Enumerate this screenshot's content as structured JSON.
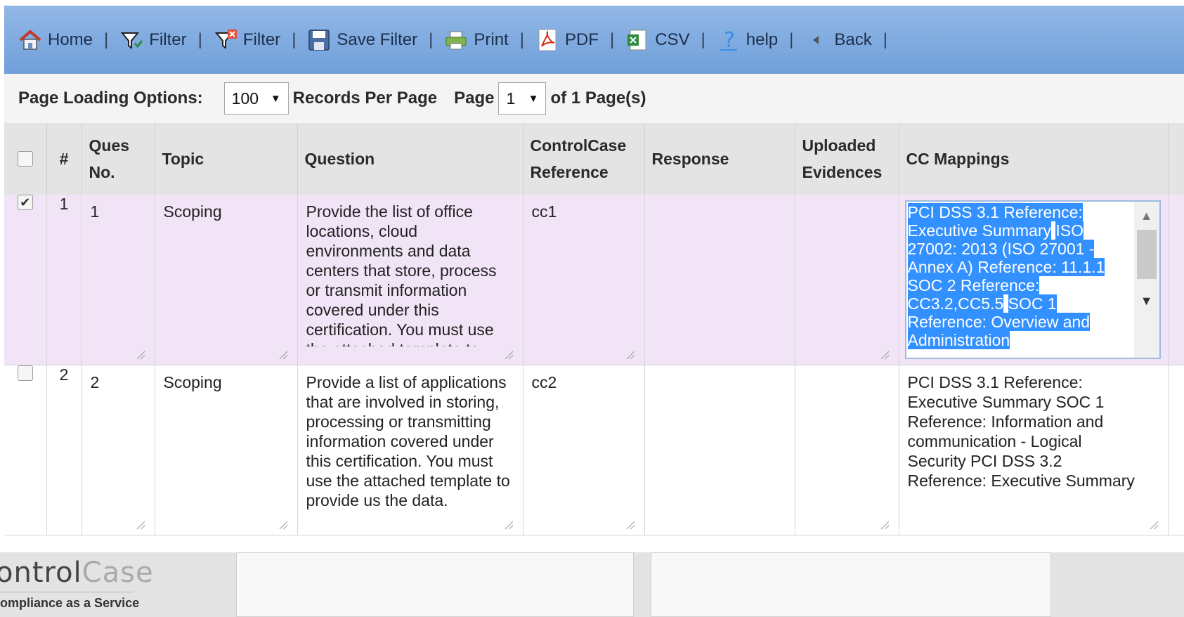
{
  "toolbar": {
    "items": [
      {
        "label": "Home",
        "icon": "home-icon"
      },
      {
        "label": "Filter",
        "icon": "filter-icon"
      },
      {
        "label": "Filter",
        "icon": "clear-filter-icon"
      },
      {
        "label": "Save Filter",
        "icon": "save-icon"
      },
      {
        "label": "Print",
        "icon": "printer-icon"
      },
      {
        "label": "PDF",
        "icon": "pdf-icon"
      },
      {
        "label": "CSV",
        "icon": "csv-icon"
      },
      {
        "label": "help",
        "icon": "help-icon"
      },
      {
        "label": "Back",
        "icon": "back-arrow-icon"
      }
    ],
    "separator": "|"
  },
  "options": {
    "label": "Page Loading Options:",
    "records_per_page": "100",
    "records_label": "Records Per Page",
    "page_label": "Page",
    "page_value": "1",
    "of_pages": "of 1 Page(s)"
  },
  "table": {
    "headers": {
      "num": "#",
      "ques_no": [
        "Ques",
        "No."
      ],
      "topic": "Topic",
      "question": "Question",
      "reference": [
        "ControlCase",
        "Reference"
      ],
      "response": "Response",
      "evidences": [
        "Uploaded",
        "Evidences"
      ],
      "mappings": "CC Mappings"
    },
    "rows": [
      {
        "checked": true,
        "num": "1",
        "ques_no": "1",
        "topic": "Scoping",
        "question": "Provide the list of office locations, cloud environments and data centers that store, process or transmit information covered under this certification. You must use the attached template to provide us the data.",
        "reference": "cc1",
        "response": "",
        "evidences": "",
        "mappings": [
          "PCI DSS 3.1 Reference: Executive Summary",
          "ISO 27002: 2013 (ISO 27001 -Annex A) Reference: 11.1.1",
          "SOC 2 Reference: CC3.2,CC5.5",
          "SOC 1 Reference: Overview and Administration"
        ]
      },
      {
        "checked": false,
        "num": "2",
        "ques_no": "2",
        "topic": "Scoping",
        "question": "Provide a list of applications that are involved in storing, processing or transmitting information covered under this certification. You must use the attached template to provide us the data.",
        "reference": "cc2",
        "response": "",
        "evidences": "",
        "mappings": [
          "PCI DSS 3.1 Reference: Executive Summary",
          "SOC 1 Reference: Information and communication - Logical Security",
          "PCI DSS 3.2 Reference: Executive Summary"
        ]
      }
    ]
  },
  "logo": {
    "brand_part1": "ontrol",
    "brand_part2": "Case",
    "tagline": "ompliance as a Service"
  },
  "colors": {
    "toolbar": "#7fa9de",
    "selected_row": "#f1e4f7",
    "selection_highlight": "#3290ff"
  }
}
